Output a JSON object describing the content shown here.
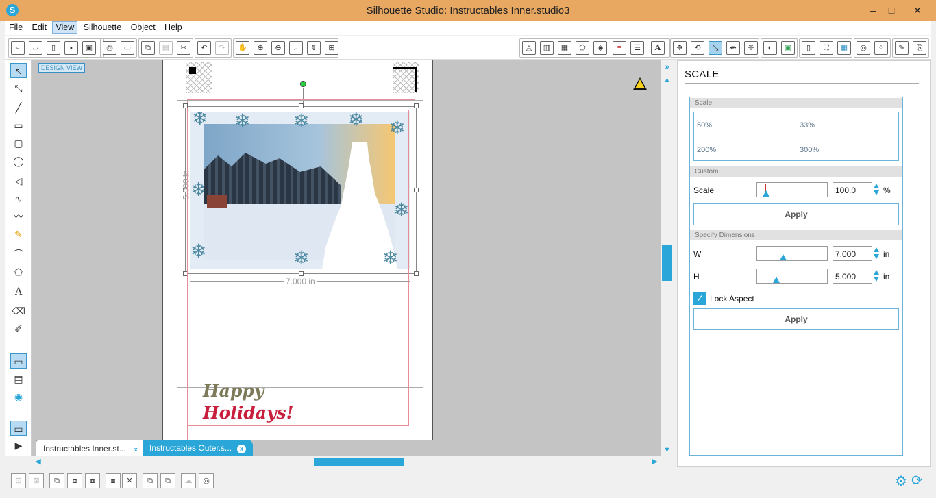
{
  "window": {
    "title": "Silhouette Studio: Instructables Inner.studio3",
    "min": "–",
    "max": "□",
    "close": "✕"
  },
  "menu": {
    "items": [
      "File",
      "Edit",
      "View",
      "Silhouette",
      "Object",
      "Help"
    ],
    "active": "View"
  },
  "canvas": {
    "view_label": "DESIGN VIEW",
    "dim_height": "5.000 in",
    "dim_width": "7.000 in",
    "greeting_line1": "Happy",
    "greeting_line2": "Holidays!"
  },
  "tabs": [
    {
      "label": "Instructables Inner.st...",
      "close": "x"
    },
    {
      "label": "Instructables Outer.s...",
      "close": "x"
    }
  ],
  "panel": {
    "title": "SCALE",
    "scale_section": "Scale",
    "presets": [
      "50%",
      "33%",
      "200%",
      "300%"
    ],
    "custom_section": "Custom",
    "scale_label": "Scale",
    "scale_value": "100.0",
    "scale_unit": "%",
    "apply_label": "Apply",
    "dimensions_section": "Specify Dimensions",
    "w_label": "W",
    "w_value": "7.000",
    "h_label": "H",
    "h_value": "5.000",
    "dim_unit": "in",
    "lock_aspect": "Lock Aspect",
    "lock_checked": true
  },
  "colors": {
    "accent": "#2aa6d8",
    "titlebar": "#e8a862",
    "canvas_bg": "#c4c4c4"
  }
}
